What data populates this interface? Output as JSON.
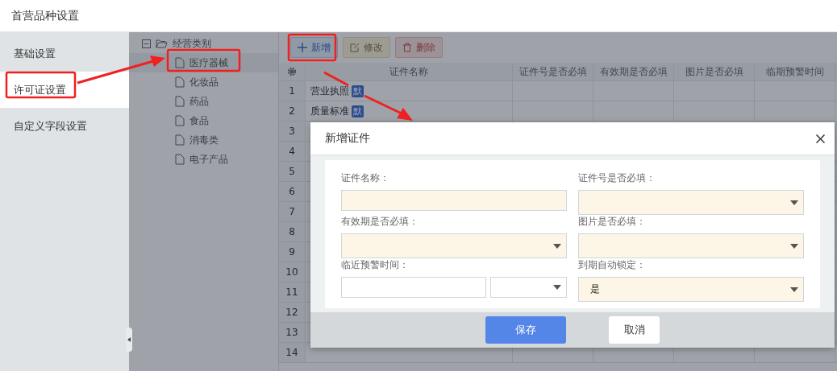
{
  "page": {
    "title": "首营品种设置"
  },
  "sidebar": {
    "items": [
      {
        "label": "基础设置",
        "selected": false
      },
      {
        "label": "许可证设置",
        "selected": true
      },
      {
        "label": "自定义字段设置",
        "selected": false
      }
    ]
  },
  "tree": {
    "root": {
      "label": "经营类别",
      "expanded": true,
      "children": [
        {
          "label": "医疗器械",
          "selected": true
        },
        {
          "label": "化妆品",
          "selected": false
        },
        {
          "label": "药品",
          "selected": false
        },
        {
          "label": "食品",
          "selected": false
        },
        {
          "label": "消毒类",
          "selected": false
        },
        {
          "label": "电子产品",
          "selected": false
        }
      ]
    }
  },
  "toolbar": {
    "buttons": [
      {
        "label": "新增",
        "kind": "add"
      },
      {
        "label": "修改",
        "kind": "edit"
      },
      {
        "label": "删除",
        "kind": "delete"
      }
    ]
  },
  "table": {
    "columns": [
      "证件名称",
      "证件号是否必填",
      "有效期是否必填",
      "图片是否必填",
      "临期预警时间"
    ],
    "rows": [
      {
        "number": "1",
        "name": "营业执照",
        "badge": "默"
      },
      {
        "number": "2",
        "name": "质量标准",
        "badge": "默"
      },
      {
        "number": "3"
      },
      {
        "number": "4"
      },
      {
        "number": "5"
      },
      {
        "number": "6"
      },
      {
        "number": "7"
      },
      {
        "number": "8"
      },
      {
        "number": "9"
      },
      {
        "number": "10"
      },
      {
        "number": "11"
      },
      {
        "number": "12"
      },
      {
        "number": "13"
      },
      {
        "number": "14"
      }
    ]
  },
  "dialog": {
    "title": "新增证件",
    "fields": [
      {
        "label": "证件名称：",
        "kind": "text",
        "required": true
      },
      {
        "label": "证件号是否必填：",
        "kind": "select",
        "required": true
      },
      {
        "label": "有效期是否必填：",
        "kind": "select",
        "required": true
      },
      {
        "label": "图片是否必填：",
        "kind": "select",
        "required": true
      },
      {
        "label": "临近预警时间：",
        "kind": "text-select",
        "required": false
      },
      {
        "label": "到期自动锁定：",
        "kind": "select",
        "required": true,
        "value": "是"
      }
    ],
    "buttons": [
      {
        "label": "保存",
        "primary": true
      },
      {
        "label": "取消",
        "primary": false
      }
    ]
  }
}
